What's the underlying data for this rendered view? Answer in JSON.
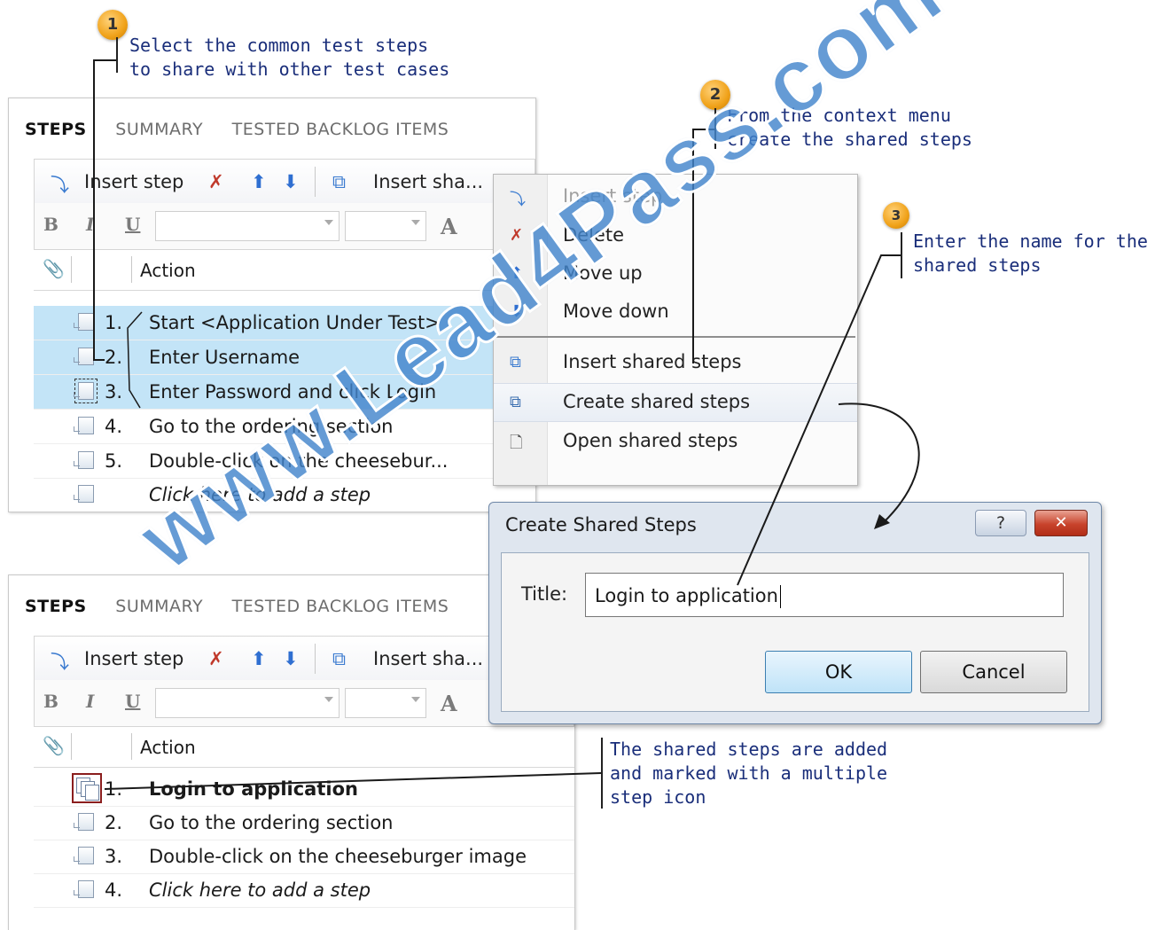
{
  "callouts": {
    "c1": {
      "number": "1",
      "line1": "Select the common test steps",
      "line2": "to share with other test cases"
    },
    "c2": {
      "number": "2",
      "line1": "From the context menu",
      "line2": "create the shared steps"
    },
    "c3": {
      "number": "3",
      "line1": "Enter the name for the",
      "line2": "shared steps"
    },
    "c4": {
      "line1": "The shared steps are added",
      "line2": "and marked with a multiple",
      "line3": "step icon"
    }
  },
  "top_panel": {
    "tabs": [
      "STEPS",
      "SUMMARY",
      "TESTED BACKLOG ITEMS"
    ],
    "toolbar": {
      "insert_step": "Insert step",
      "insert_shared": "Insert sha..."
    },
    "format": {
      "bold": "B",
      "italic": "I",
      "underline": "U",
      "font_color": "A"
    },
    "grid_header": "Action",
    "rows": [
      {
        "num": "1.",
        "text": "Start <Application Under Test>"
      },
      {
        "num": "2.",
        "text": "Enter Username"
      },
      {
        "num": "3.",
        "text": "Enter Password and click Login"
      },
      {
        "num": "4.",
        "text": "Go to the ordering section"
      },
      {
        "num": "5.",
        "text": "Double-click on the cheesebur..."
      },
      {
        "num": "",
        "text": "Click here to add a step"
      }
    ]
  },
  "context_menu": {
    "items": [
      "Insert step",
      "Delete",
      "Move up",
      "Move down",
      "Insert shared steps",
      "Create shared steps",
      "Open shared steps"
    ]
  },
  "dialog": {
    "title": "Create Shared Steps",
    "help": "?",
    "close": "✕",
    "label": "Title:",
    "value": "Login to application",
    "ok": "OK",
    "cancel": "Cancel"
  },
  "bottom_panel": {
    "tabs": [
      "STEPS",
      "SUMMARY",
      "TESTED BACKLOG ITEMS"
    ],
    "toolbar": {
      "insert_step": "Insert step",
      "insert_shared": "Insert sha..."
    },
    "format": {
      "bold": "B",
      "italic": "I",
      "underline": "U",
      "font_color": "A"
    },
    "grid_header": "Action",
    "rows": [
      {
        "num": "1.",
        "text": "Login to application"
      },
      {
        "num": "2.",
        "text": "Go to the ordering section"
      },
      {
        "num": "3.",
        "text": "Double-click on the cheeseburger image"
      },
      {
        "num": "4.",
        "text": "Click here to add a step"
      }
    ]
  },
  "watermark": "www.Lead4Pass.com",
  "icons": {
    "attachment": "paperclip-icon",
    "insert": "insert-step-icon",
    "delete": "delete-icon",
    "up": "arrow-up-icon",
    "down": "arrow-down-icon"
  },
  "colors": {
    "selection": "#c3e4f7",
    "callout_text": "#1a2e7a",
    "callout_badge": "#f0a21a",
    "close_button": "#c8432c"
  }
}
